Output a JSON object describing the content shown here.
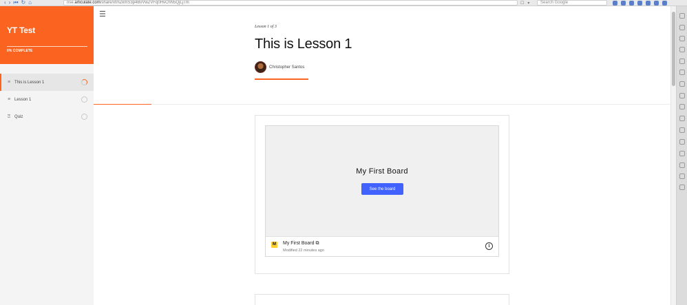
{
  "browser": {
    "url_prefix": "rise.",
    "url_domain": "articulate.com",
    "url_path": "/share/xtmZkmS3p4BvVwZVFq0HvChN5QjLjTm",
    "search_placeholder": "Search Google"
  },
  "sidebar": {
    "course_title": "YT Test",
    "progress_text": "0% COMPLETE",
    "items": [
      {
        "label": "This is Lesson 1",
        "icon": "lines-icon",
        "active": true
      },
      {
        "label": "Lesson 1",
        "icon": "lines-icon",
        "active": false
      },
      {
        "label": "Quiz",
        "icon": "question-icon",
        "active": false
      }
    ]
  },
  "lesson": {
    "count": "Lesson 1 of 3",
    "title": "This is Lesson 1",
    "author": "Christopher Santos"
  },
  "embed": {
    "board_title": "My First Board",
    "button_label": "See the board",
    "footer_name": "My First Board",
    "modified": "Modified 22 minutes ago",
    "logo_text": "M"
  },
  "colors": {
    "accent": "#fb6420",
    "button": "#4262ff"
  }
}
